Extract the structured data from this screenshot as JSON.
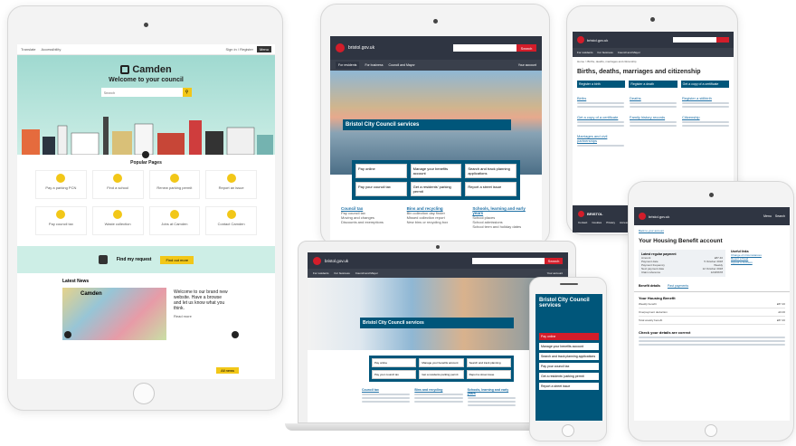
{
  "camden": {
    "top_links": [
      "Translate",
      "Accessibility"
    ],
    "sign_in": "Sign in / Register",
    "menu": "Menu",
    "logo": "Camden",
    "welcome": "Welcome to your council",
    "search_placeholder": "Search",
    "popular_heading": "Popular Pages",
    "tiles": [
      "Pay a parking PCN",
      "Find a school",
      "Renew parking permit",
      "Report an issue",
      "Pay council tax",
      "Waste collection",
      "Jobs at Camden",
      "Contact Camden"
    ],
    "find_request_title": "Find my request",
    "find_request_button": "Find out more",
    "latest_news": "Latest News",
    "news_logo": "Camden",
    "news_title": "Welcome to our brand new website. Have a browse and let us know what you think.",
    "news_more": "Read more",
    "all_news": "All news"
  },
  "bristol_top": {
    "site": "bristol.gov.uk",
    "search_button": "Search",
    "tabs": [
      "For residents",
      "For business",
      "Council and Mayor"
    ],
    "your_account": "Your account",
    "hero_title": "Bristol City Council services",
    "services": [
      "Pay online",
      "Manage your benefits account",
      "Search and track planning applications",
      "Pay your council tax",
      "Get a residents' parking permit",
      "Report a street issue"
    ],
    "columns": [
      "Council tax",
      "Bins and recycling",
      "Schools, learning and early years"
    ],
    "links": [
      [
        "Pay council tax",
        "Moving and changes",
        "Discounts and exemptions"
      ],
      [
        "Bin collection day finder",
        "Missed collection report",
        "New bins or recycling box"
      ],
      [
        "School places",
        "School admissions",
        "School term and holiday dates"
      ]
    ]
  },
  "births": {
    "site": "bristol.gov.uk",
    "tabs": [
      "For residents",
      "For business",
      "Council and Mayor"
    ],
    "breadcrumb": "Home > Births, deaths, marriages and citizenship",
    "title": "Births, deaths, marriages and citizenship",
    "buttons": [
      "Register a birth",
      "Register a death",
      "Get a copy of a certificate"
    ],
    "headings": [
      "Births",
      "Deaths",
      "Register a stillbirth",
      "Get a copy of a certificate",
      "Family history records",
      "Citizenship",
      "Marriages and civil partnerships"
    ],
    "footer_logo": "BRISTOL",
    "footer_links": [
      "Contact",
      "Cookies",
      "Privacy",
      "Accessibility"
    ]
  },
  "housing": {
    "site": "bristol.gov.uk",
    "menu": "Menu",
    "search": "Search",
    "breadcrumb": "Back to your account",
    "title": "Your Housing Benefit account",
    "latest_heading": "Latest regular payment",
    "rows": [
      [
        "Amount",
        "£87.40"
      ],
      [
        "Payment date",
        "5 October 2018"
      ],
      [
        "Payment frequency",
        "Weekly"
      ],
      [
        "Next payment date",
        "12 October 2018"
      ],
      [
        "Claim reference",
        "12345678"
      ]
    ],
    "links_heading": "Useful links",
    "links": [
      "Change of circumstances",
      "Report a fraud",
      "Appeal a decision"
    ],
    "tab_details": "Benefit details",
    "tab_payments": "Past payments",
    "section": "Your Housing Benefit",
    "section_rows": [
      [
        "Weekly benefit",
        "£87.40"
      ],
      [
        "Overpayment deduction",
        "£0.00"
      ],
      [
        "Total weekly benefit",
        "£87.40"
      ]
    ],
    "check_heading": "Check your details are correct"
  },
  "laptop": {
    "site": "bristol.gov.uk",
    "search_button": "Search",
    "tabs": [
      "For residents",
      "For business",
      "Council and Mayor"
    ],
    "your_account": "Your account",
    "hero_title": "Bristol City Council services",
    "services": [
      "Pay online",
      "Manage your benefits account",
      "Search and track planning",
      "Pay your council tax",
      "Get a residents parking permit",
      "Report a street issue"
    ],
    "columns": [
      "Council tax",
      "Bins and recycling",
      "Schools, learning and early years"
    ]
  },
  "phone": {
    "hero_title": "Bristol City Council services",
    "items": [
      "Pay online",
      "Manage your benefits account",
      "Search and track planning applications",
      "Pay your council tax",
      "Get a residents' parking permit",
      "Report a street issue"
    ]
  }
}
